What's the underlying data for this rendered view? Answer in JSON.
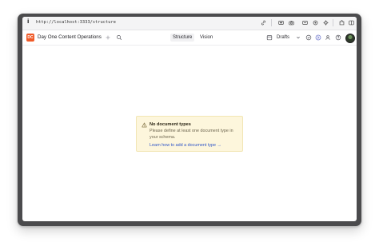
{
  "browser": {
    "info_glyph": "i",
    "url": "http://localhost:3333/structure",
    "icons": [
      "link-icon",
      "screenshot-icon",
      "camera-icon",
      "panel-icon",
      "target-icon",
      "settings-icon",
      "extension-icon",
      "sidebar-icon"
    ]
  },
  "app": {
    "logo_text": "DC",
    "workspace_title": "Day One Content Operations",
    "tabs": [
      {
        "label": "Structure",
        "active": true
      },
      {
        "label": "Vision",
        "active": false
      }
    ],
    "perspective_label": "Drafts"
  },
  "notice": {
    "title": "No document types",
    "body": "Please define at least one document type in your schema.",
    "link": "Learn how to add a document type →"
  },
  "colors": {
    "brand": "#f05a28",
    "notice_bg": "#fdf6dc",
    "link": "#2f55c8"
  }
}
